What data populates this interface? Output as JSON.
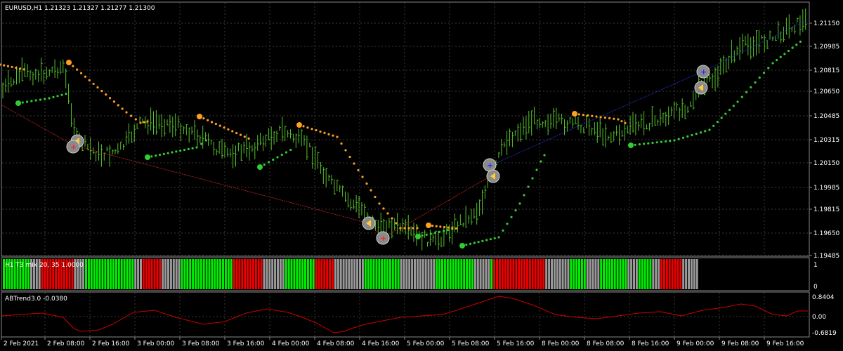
{
  "main_title": "EURUSD,H1  1.21323 1.21327 1.21277 1.21300",
  "price_labels": [
    "1.21150",
    "1.20985",
    "1.20815",
    "1.20650",
    "1.20485",
    "1.20315",
    "1.20150",
    "1.19985",
    "1.19815",
    "1.19650",
    "1.19485"
  ],
  "hist_title": "H1 T3 mix 20, 35 1.0000",
  "hist_labels": [
    "1",
    "0"
  ],
  "ab_title": "ABTrend3.0 -0.0380",
  "ab_labels": [
    "0.8404",
    "0.00",
    "-0.6819"
  ],
  "time_labels": [
    "2 Feb 2021",
    "2 Feb 08:00",
    "2 Feb 16:00",
    "3 Feb 00:00",
    "3 Feb 08:00",
    "3 Feb 16:00",
    "4 Feb 00:00",
    "4 Feb 08:00",
    "4 Feb 16:00",
    "5 Feb 00:00",
    "5 Feb 08:00",
    "5 Feb 16:00",
    "8 Feb 00:00",
    "8 Feb 08:00",
    "8 Feb 16:00",
    "9 Feb 00:00",
    "9 Feb 08:00",
    "9 Feb 16:00"
  ],
  "colors": {
    "background": "#000000",
    "grid": "#3a3a3a",
    "bar": "#55c22a",
    "sar_orange": "#ffa020",
    "sar_green": "#33cc33",
    "zigzag_red": "#cc2222",
    "zigzag_blue": "#2233cc",
    "hist_green": "#00ee00",
    "hist_red": "#ee0000",
    "hist_gray": "#999999",
    "ab_line": "#cc0000"
  },
  "hist_segments": [
    [
      "green",
      10
    ],
    [
      "gray",
      4
    ],
    [
      "red",
      12
    ],
    [
      "gray",
      4
    ],
    [
      "green",
      18
    ],
    [
      "gray",
      3
    ],
    [
      "red",
      7
    ],
    [
      "gray",
      7
    ],
    [
      "green",
      19
    ],
    [
      "red",
      11
    ],
    [
      "gray",
      8
    ],
    [
      "green",
      11
    ],
    [
      "red",
      7
    ],
    [
      "gray",
      11
    ],
    [
      "green",
      13
    ],
    [
      "gray",
      13
    ],
    [
      "green",
      14
    ],
    [
      "gray",
      6
    ],
    [
      "green",
      1
    ],
    [
      "red",
      19
    ],
    [
      "gray",
      9
    ],
    [
      "green",
      6
    ],
    [
      "gray",
      5
    ],
    [
      "green",
      10
    ],
    [
      "gray",
      4
    ],
    [
      "green",
      5
    ],
    [
      "gray",
      3
    ],
    [
      "red",
      8
    ],
    [
      "gray",
      6
    ]
  ],
  "price_range": [
    1.194,
    1.213
  ]
}
